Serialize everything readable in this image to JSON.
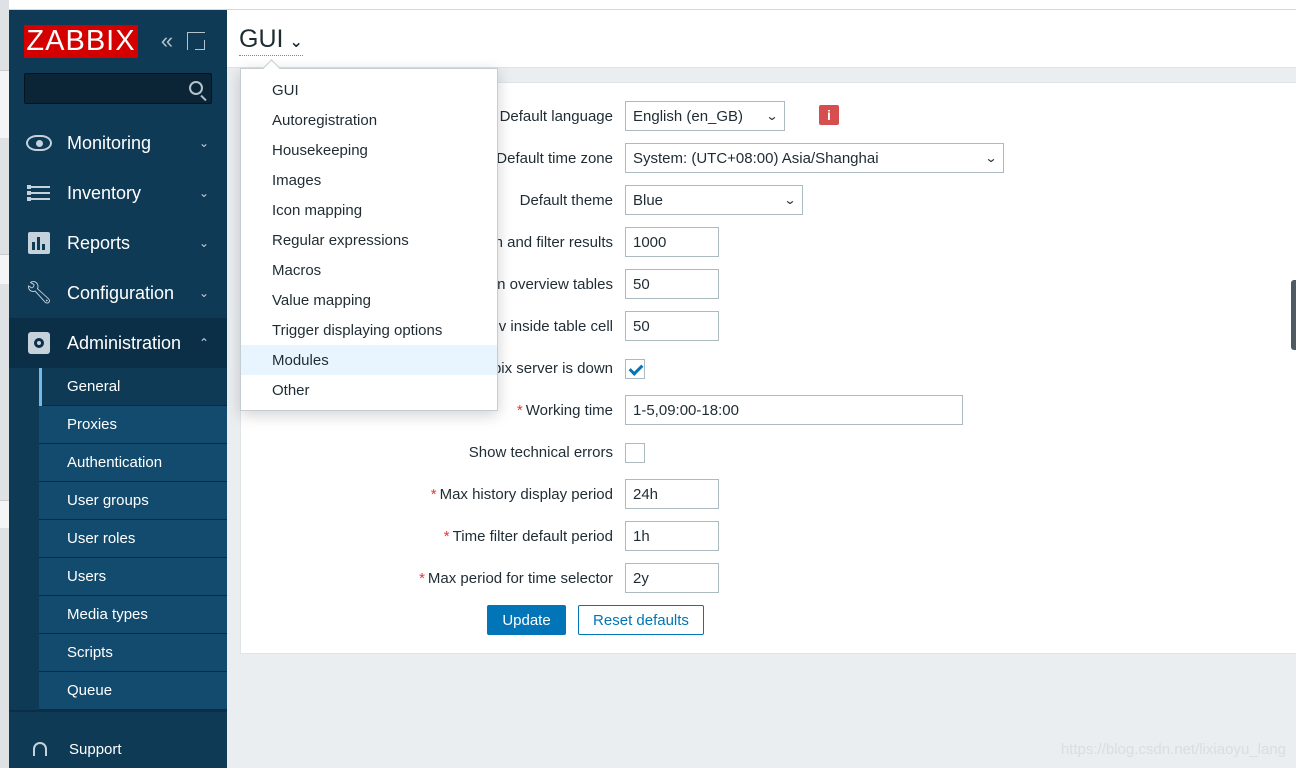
{
  "brand": {
    "logo_text": "ZABBIX",
    "accent": "#d40000",
    "sidebar_bg": "#0e3a56"
  },
  "sidebar": {
    "search_placeholder": "",
    "menu": [
      {
        "label": "Monitoring",
        "icon": "eye-icon",
        "chevron": "⌄"
      },
      {
        "label": "Inventory",
        "icon": "list-icon",
        "chevron": "⌄"
      },
      {
        "label": "Reports",
        "icon": "bar-chart-icon",
        "chevron": "⌄"
      },
      {
        "label": "Configuration",
        "icon": "wrench-icon",
        "chevron": "⌄"
      },
      {
        "label": "Administration",
        "icon": "gear-icon",
        "chevron": "⌃"
      }
    ],
    "submenu": [
      "General",
      "Proxies",
      "Authentication",
      "User groups",
      "User roles",
      "Users",
      "Media types",
      "Scripts",
      "Queue"
    ],
    "support_label": "Support"
  },
  "header": {
    "title": "GUI"
  },
  "dropdown": {
    "items": [
      "GUI",
      "Autoregistration",
      "Housekeeping",
      "Images",
      "Icon mapping",
      "Regular expressions",
      "Macros",
      "Value mapping",
      "Trigger displaying options",
      "Modules",
      "Other"
    ],
    "hovered": "Modules"
  },
  "form": {
    "rows": [
      {
        "label": "Default language",
        "value": "English (en_GB)",
        "type": "select"
      },
      {
        "label": "Default time zone",
        "value": "System: (UTC+08:00) Asia/Shanghai",
        "type": "select"
      },
      {
        "label": "Default theme",
        "value": "Blue",
        "type": "select"
      },
      {
        "label": "n and filter results",
        "value": "1000",
        "type": "text"
      },
      {
        "label": "n overview tables",
        "value": "50",
        "type": "text"
      },
      {
        "label": "v inside table cell",
        "value": "50",
        "type": "text"
      },
      {
        "label": "bix server is down",
        "value": "",
        "type": "checkbox",
        "checked": true
      },
      {
        "label": "Working time",
        "value": "1-5,09:00-18:00",
        "type": "text",
        "required": true
      },
      {
        "label": "Show technical errors",
        "value": "",
        "type": "checkbox",
        "checked": false
      },
      {
        "label": "Max history display period",
        "value": "24h",
        "type": "text",
        "required": true
      },
      {
        "label": "Time filter default period",
        "value": "1h",
        "type": "text",
        "required": true
      },
      {
        "label": "Max period for time selector",
        "value": "2y",
        "type": "text",
        "required": true
      }
    ],
    "required_mark": "*",
    "info_icon_text": "i",
    "update_label": "Update",
    "reset_label": "Reset defaults"
  },
  "watermark": "https://blog.csdn.net/lixiaoyu_lang"
}
